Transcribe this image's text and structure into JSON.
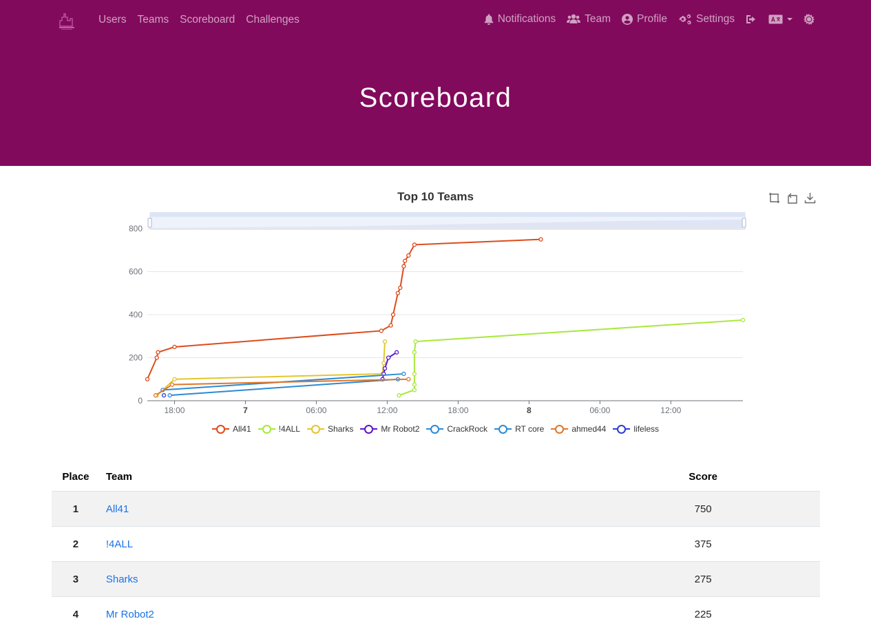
{
  "nav": {
    "brand_logo": "ctf-logo",
    "left_links": [
      "Users",
      "Teams",
      "Scoreboard",
      "Challenges"
    ],
    "notifications": "Notifications",
    "team": "Team",
    "profile": "Profile",
    "settings": "Settings",
    "icons": {
      "notifications": "bell-icon",
      "team": "users-icon",
      "profile": "user-circle-icon",
      "settings": "gears-icon",
      "logout": "sign-out-icon",
      "language": "language-icon",
      "theme": "sun-icon"
    }
  },
  "page": {
    "title": "Scoreboard",
    "accent_color": "#820a5d"
  },
  "chart_data": {
    "type": "line",
    "title": "Top 10 Teams",
    "x_tick_labels": [
      "18:00",
      "7",
      "06:00",
      "12:00",
      "18:00",
      "8",
      "06:00",
      "12:00"
    ],
    "y_ticks": [
      0,
      200,
      400,
      600,
      800
    ],
    "ylim": [
      0,
      800
    ],
    "x_unit": "hours from start",
    "xlim": [
      -2.3,
      48.1
    ],
    "legend_position": "bottom",
    "grid": true,
    "series": [
      {
        "name": "All41",
        "color": "#dd4b1a",
        "x": [
          -2.3,
          -1.5,
          -1.4,
          0,
          17.5,
          18.3,
          18.5,
          18.9,
          19.1,
          19.4,
          19.5,
          19.8,
          20.3,
          31.0
        ],
        "y": [
          100,
          200,
          225,
          250,
          325,
          350,
          400,
          500,
          525,
          625,
          650,
          675,
          725,
          750
        ]
      },
      {
        "name": "!4ALL",
        "color": "#a7e83a",
        "x": [
          19.0,
          20.3,
          20.3,
          20.3,
          20.3,
          20.4,
          48.1
        ],
        "y": [
          25,
          50,
          75,
          125,
          225,
          275,
          375
        ]
      },
      {
        "name": "Sharks",
        "color": "#e3c62a",
        "x": [
          -1.5,
          0,
          17.6,
          17.7,
          17.8
        ],
        "y": [
          25,
          100,
          125,
          175,
          275
        ]
      },
      {
        "name": "Mr Robot2",
        "color": "#5c14c9",
        "x": [
          17.6,
          17.7,
          17.8,
          18.1,
          18.8
        ],
        "y": [
          100,
          125,
          150,
          200,
          225
        ]
      },
      {
        "name": "CrackRock",
        "color": "#2b8ad4",
        "x": [
          -1.0,
          19.4
        ],
        "y": [
          50,
          125
        ]
      },
      {
        "name": "RT core",
        "color": "#2b8ad4",
        "x": [
          -0.4,
          18.9
        ],
        "y": [
          25,
          100
        ]
      },
      {
        "name": "ahmed44",
        "color": "#e0762a",
        "x": [
          -1.6,
          -0.2,
          19.8
        ],
        "y": [
          25,
          75,
          100
        ]
      },
      {
        "name": "lifeless",
        "color": "#2b3bd4",
        "x": [
          -0.9
        ],
        "y": [
          25
        ]
      }
    ]
  },
  "scoreboard": {
    "headers": {
      "place": "Place",
      "team": "Team",
      "score": "Score"
    },
    "rows": [
      {
        "place": "1",
        "team": "All41",
        "score": "750"
      },
      {
        "place": "2",
        "team": "!4ALL",
        "score": "375"
      },
      {
        "place": "3",
        "team": "Sharks",
        "score": "275"
      },
      {
        "place": "4",
        "team": "Mr Robot2",
        "score": "225"
      }
    ]
  }
}
